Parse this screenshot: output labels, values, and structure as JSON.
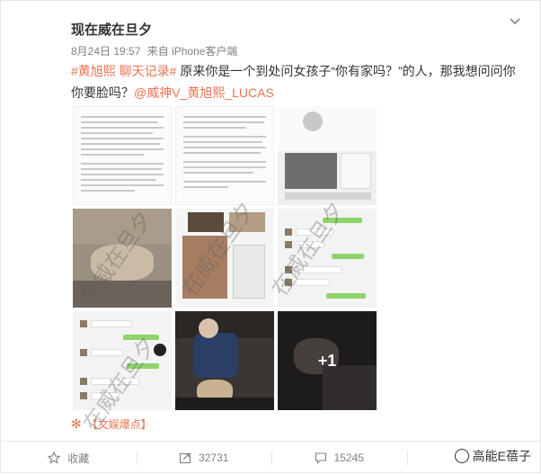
{
  "post": {
    "author": "现在威在旦夕",
    "date": "8月24日 19:57",
    "source": "来自 iPhone客户端",
    "hashtag": "#黄旭熙 聊天记录#",
    "text_main": " 原来你是一个到处问女孩子“你有家吗？”的人，那我想问问你你要脸吗？",
    "mention": "@威神V_黄旭熙_LUCAS",
    "location": "【文娱爆点】",
    "more_count": "+1"
  },
  "actions": {
    "collect": "收藏",
    "repost": "32731",
    "comment": "15245"
  },
  "overlay_watermark": "高能E蓓子",
  "photo_watermark": "在威在旦夕",
  "icons": {
    "chevron": "chevron-down-icon",
    "location": "location-icon",
    "collect": "star-icon",
    "repost": "share-icon",
    "comment": "comment-icon",
    "source": "avatar-icon"
  },
  "colors": {
    "accent": "#eb7350",
    "text": "#333333",
    "muted": "#808080"
  }
}
